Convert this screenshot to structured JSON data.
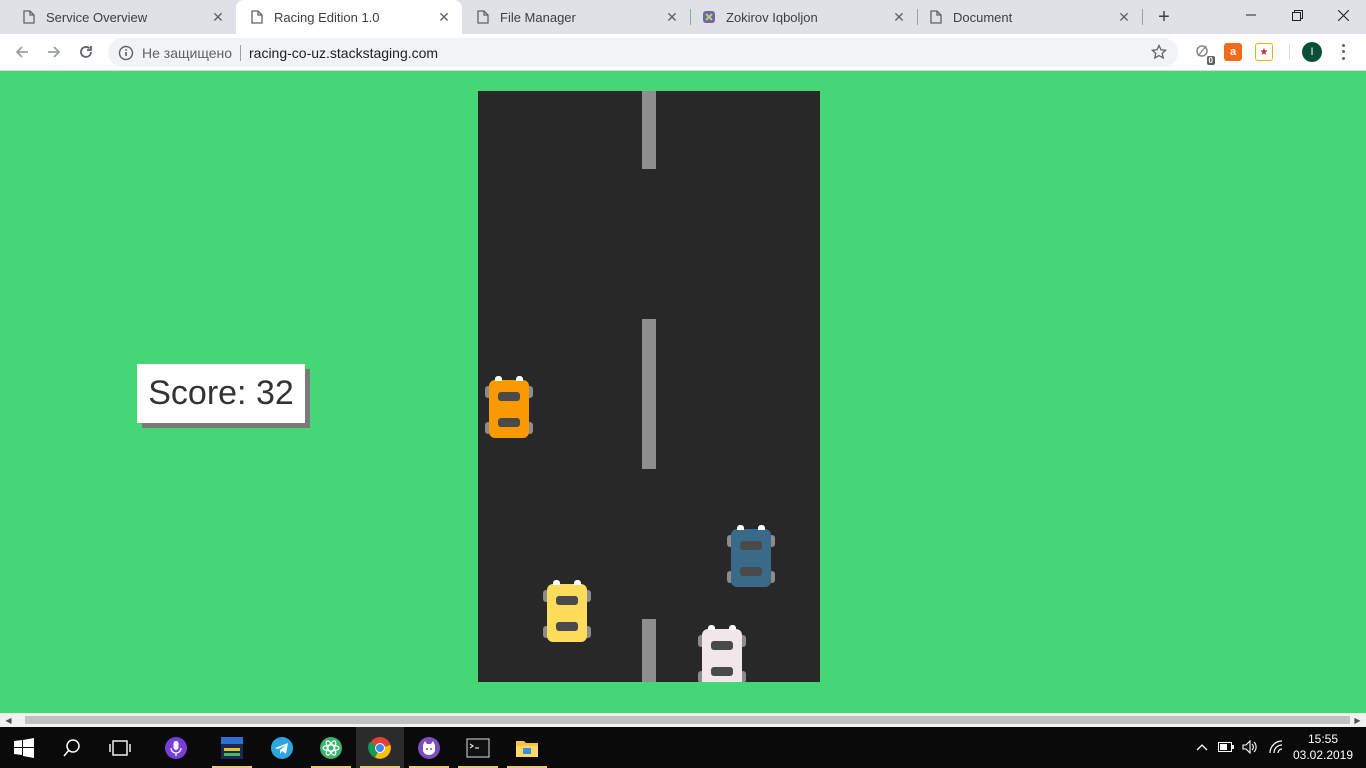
{
  "browser": {
    "tabs": [
      {
        "title": "Service Overview",
        "active": false,
        "icon": "page-icon"
      },
      {
        "title": "Racing Edition 1.0",
        "active": true,
        "icon": "page-icon"
      },
      {
        "title": "File Manager",
        "active": false,
        "icon": "page-icon"
      },
      {
        "title": "Zokirov Iqboljon",
        "active": false,
        "icon": "app-icon"
      },
      {
        "title": "Document",
        "active": false,
        "icon": "page-icon"
      }
    ],
    "omnibox": {
      "security_label": "Не защищено",
      "url": "racing-co-uz.stackstaging.com"
    },
    "extensions": [
      {
        "name": "downloads-extension-icon",
        "badge": "0"
      },
      {
        "name": "aliexpress-extension-icon",
        "label": "a"
      },
      {
        "name": "shopping-extension-icon",
        "label": "★"
      }
    ],
    "profile_initial": "I"
  },
  "game": {
    "score_label": "Score: 32",
    "colors": {
      "background": "#46d676",
      "road": "#282828",
      "lane_line": "#8e8e8e",
      "player_car": "#fb9a00",
      "enemy_yellow": "#fddc5c",
      "enemy_blue": "#3a6a8a",
      "enemy_white": "#f1e6ea"
    }
  },
  "taskbar": {
    "apps": [
      "start-button",
      "search-icon",
      "task-view-icon",
      "cortana-mic-icon",
      "calendar-app-icon",
      "telegram-icon",
      "atom-icon",
      "chrome-icon",
      "github-desktop-icon",
      "terminal-icon",
      "file-explorer-icon"
    ],
    "time": "15:55",
    "date": "03.02.2019"
  }
}
